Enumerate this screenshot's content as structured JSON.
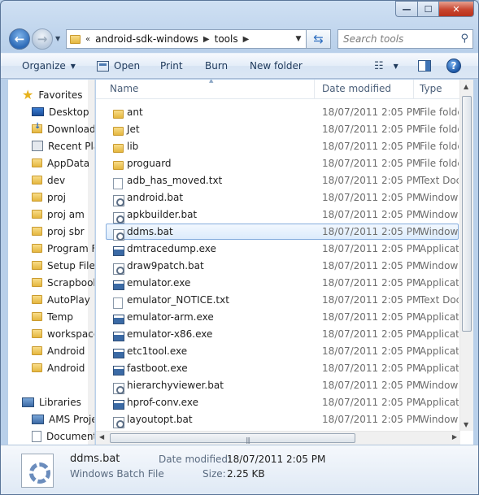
{
  "window": {
    "min_glyph": "—",
    "max_glyph": "☐",
    "close_glyph": "✕"
  },
  "nav": {
    "back_glyph": "←",
    "forward_glyph": "→",
    "address_chevrons": "«",
    "path": [
      "android-sdk-windows",
      "tools"
    ],
    "search_placeholder": "Search tools"
  },
  "toolbar": {
    "organize": "Organize",
    "open": "Open",
    "print": "Print",
    "burn": "Burn",
    "new_folder": "New folder"
  },
  "sidebar": {
    "favorites_label": "Favorites",
    "favorites": [
      {
        "label": "Desktop",
        "icon": "desktop-icon"
      },
      {
        "label": "Downloads",
        "icon": "downloads-icon"
      },
      {
        "label": "Recent Places",
        "icon": "recent-places-icon"
      },
      {
        "label": "AppData",
        "icon": "folder-icon"
      },
      {
        "label": "dev",
        "icon": "folder-icon"
      },
      {
        "label": "proj",
        "icon": "folder-icon"
      },
      {
        "label": "proj am",
        "icon": "folder-icon"
      },
      {
        "label": "proj sbr",
        "icon": "folder-icon"
      },
      {
        "label": "Program Files",
        "icon": "folder-icon"
      },
      {
        "label": "Setup Files",
        "icon": "folder-icon"
      },
      {
        "label": "Scrapbook",
        "icon": "folder-icon"
      },
      {
        "label": "AutoPlay",
        "icon": "folder-icon"
      },
      {
        "label": "Temp",
        "icon": "folder-icon"
      },
      {
        "label": "workspace",
        "icon": "folder-icon"
      },
      {
        "label": "Android",
        "icon": "folder-icon"
      },
      {
        "label": "Android",
        "icon": "folder-icon"
      }
    ],
    "libraries_label": "Libraries",
    "libraries": [
      {
        "label": "AMS Projects",
        "icon": "library-icon"
      },
      {
        "label": "Documents",
        "icon": "documents-icon"
      }
    ]
  },
  "columns": {
    "name": "Name",
    "date_modified": "Date modified",
    "type": "Type"
  },
  "files": [
    {
      "name": "ant",
      "date": "18/07/2011 2:05 PM",
      "type": "File folder",
      "icon": "folder"
    },
    {
      "name": "Jet",
      "date": "18/07/2011 2:05 PM",
      "type": "File folder",
      "icon": "folder"
    },
    {
      "name": "lib",
      "date": "18/07/2011 2:05 PM",
      "type": "File folder",
      "icon": "folder"
    },
    {
      "name": "proguard",
      "date": "18/07/2011 2:05 PM",
      "type": "File folder",
      "icon": "folder"
    },
    {
      "name": "adb_has_moved.txt",
      "date": "18/07/2011 2:05 PM",
      "type": "Text Document",
      "icon": "text"
    },
    {
      "name": "android.bat",
      "date": "18/07/2011 2:05 PM",
      "type": "Windows Batch File",
      "icon": "bat"
    },
    {
      "name": "apkbuilder.bat",
      "date": "18/07/2011 2:05 PM",
      "type": "Windows Batch File",
      "icon": "bat"
    },
    {
      "name": "ddms.bat",
      "date": "18/07/2011 2:05 PM",
      "type": "Windows Batch File",
      "icon": "bat",
      "selected": true
    },
    {
      "name": "dmtracedump.exe",
      "date": "18/07/2011 2:05 PM",
      "type": "Application",
      "icon": "exe"
    },
    {
      "name": "draw9patch.bat",
      "date": "18/07/2011 2:05 PM",
      "type": "Windows Batch File",
      "icon": "bat"
    },
    {
      "name": "emulator.exe",
      "date": "18/07/2011 2:05 PM",
      "type": "Application",
      "icon": "exe"
    },
    {
      "name": "emulator_NOTICE.txt",
      "date": "18/07/2011 2:05 PM",
      "type": "Text Document",
      "icon": "text"
    },
    {
      "name": "emulator-arm.exe",
      "date": "18/07/2011 2:05 PM",
      "type": "Application",
      "icon": "exe"
    },
    {
      "name": "emulator-x86.exe",
      "date": "18/07/2011 2:05 PM",
      "type": "Application",
      "icon": "exe"
    },
    {
      "name": "etc1tool.exe",
      "date": "18/07/2011 2:05 PM",
      "type": "Application",
      "icon": "exe"
    },
    {
      "name": "fastboot.exe",
      "date": "18/07/2011 2:05 PM",
      "type": "Application",
      "icon": "exe"
    },
    {
      "name": "hierarchyviewer.bat",
      "date": "18/07/2011 2:05 PM",
      "type": "Windows Batch File",
      "icon": "bat"
    },
    {
      "name": "hprof-conv.exe",
      "date": "18/07/2011 2:05 PM",
      "type": "Application",
      "icon": "exe"
    },
    {
      "name": "layoutopt.bat",
      "date": "18/07/2011 2:05 PM",
      "type": "Windows Batch File",
      "icon": "bat"
    }
  ],
  "details": {
    "name": "ddms.bat",
    "type": "Windows Batch File",
    "date_label": "Date modified:",
    "date_value": "18/07/2011 2:05 PM",
    "size_label": "Size:",
    "size_value": "2.25 KB"
  },
  "colors": {
    "selection_border": "#84acdd",
    "selection_fill": "#dcebfc",
    "folder": "#e5b73f"
  }
}
